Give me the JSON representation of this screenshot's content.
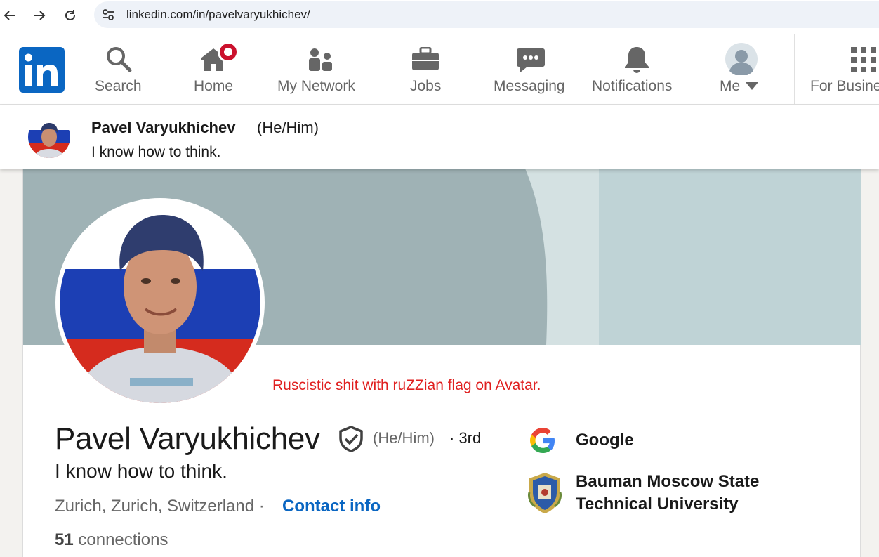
{
  "browser": {
    "url": "linkedin.com/in/pavelvaryukhichev/"
  },
  "nav": {
    "items": [
      {
        "label": "Search",
        "icon": "search-icon"
      },
      {
        "label": "Home",
        "icon": "home-icon"
      },
      {
        "label": "My Network",
        "icon": "network-icon"
      },
      {
        "label": "Jobs",
        "icon": "briefcase-icon"
      },
      {
        "label": "Messaging",
        "icon": "messaging-icon"
      },
      {
        "label": "Notifications",
        "icon": "bell-icon"
      },
      {
        "label": "Me",
        "icon": "avatar-icon"
      },
      {
        "label": "For Busine",
        "icon": "grid-icon"
      }
    ]
  },
  "sticky": {
    "name": "Pavel Varyukhichev",
    "pronouns": "(He/Him)",
    "headline": "I know how to think."
  },
  "annotation": "Ruscistic shit with ruZZian flag on Avatar.",
  "profile": {
    "name": "Pavel Varyukhichev",
    "pronouns": "(He/Him)",
    "degree": "· 3rd",
    "headline": "I know how to think.",
    "location": "Zurich, Zurich, Switzerland ·",
    "contact_label": "Contact info",
    "connections_count": "51",
    "connections_label": "connections"
  },
  "orgs": [
    {
      "name": "Google",
      "icon": "google-logo"
    },
    {
      "name_line1": "Bauman Moscow State",
      "name_line2": "Technical University",
      "icon": "university-crest"
    }
  ],
  "colors": {
    "brand": "#0a66c2",
    "annotation": "#e02020",
    "notification_badge": "#cb112d"
  }
}
